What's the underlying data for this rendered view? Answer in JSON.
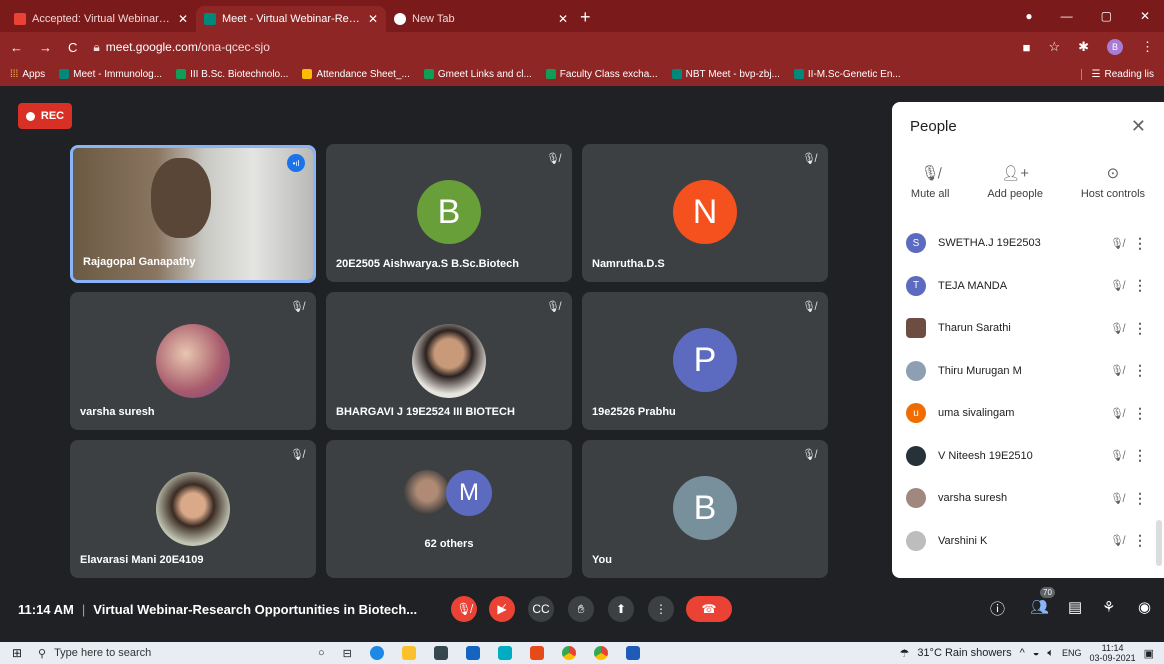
{
  "browser": {
    "tabs": [
      {
        "title": "Accepted: Virtual Webinar-Resea",
        "icon": "gmail-icon",
        "color": "#ea4335"
      },
      {
        "title": "Meet - Virtual Webinar-Resea",
        "icon": "meet-icon",
        "color": "#00897b"
      },
      {
        "title": "New Tab",
        "icon": "chrome-icon",
        "color": "#ffffff"
      }
    ],
    "url_host": "meet.google.com",
    "url_path": "/ona-qcec-sjo",
    "profile_initial": "B",
    "bookmarks": [
      "Apps",
      "Meet - Immunolog...",
      "III B.Sc. Biotechnolo...",
      "Attendance Sheet_...",
      "Gmeet Links and cl...",
      "Faculty Class excha...",
      "NBT Meet - bvp-zbj...",
      "II-M.Sc-Genetic En..."
    ],
    "reading_list": "Reading lis"
  },
  "meet": {
    "rec_label": "REC",
    "tiles": [
      {
        "name": "Rajagopal Ganapathy",
        "type": "video"
      },
      {
        "name": "20E2505 Aishwarya.S B.Sc.Biotech",
        "letter": "B",
        "color": "#689f38"
      },
      {
        "name": "Namrutha.D.S",
        "letter": "N",
        "color": "#f4511e"
      },
      {
        "name": "varsha suresh",
        "type": "photo"
      },
      {
        "name": "BHARGAVI J 19E2524 III BIOTECH",
        "type": "photo"
      },
      {
        "name": "19e2526 Prabhu",
        "letter": "P",
        "color": "#5c6bc0"
      },
      {
        "name": "Elavarasi Mani 20E4109",
        "type": "photo"
      },
      {
        "name": "62 others",
        "letter": "M",
        "color": "#5c6bc0"
      },
      {
        "name": "You",
        "letter": "B",
        "color": "#78909c"
      }
    ],
    "time": "11:14 AM",
    "meeting_title": "Virtual Webinar-Research Opportunities in Biotech...",
    "participant_count": "70"
  },
  "people": {
    "title": "People",
    "actions": [
      "Mute all",
      "Add people",
      "Host controls"
    ],
    "list": [
      {
        "name": "SWETHA.J 19E2503",
        "initial": "S",
        "color": "#5c6bc0"
      },
      {
        "name": "TEJA MANDA",
        "initial": "T",
        "color": "#5c6bc0"
      },
      {
        "name": "Tharun Sarathi",
        "initial": "",
        "color": "#6d4c41"
      },
      {
        "name": "Thiru Murugan M",
        "initial": "",
        "color": "#8d9fb3"
      },
      {
        "name": "uma sivalingam",
        "initial": "u",
        "color": "#ef6c00"
      },
      {
        "name": "V Niteesh 19E2510",
        "initial": "",
        "color": "#263238"
      },
      {
        "name": "varsha suresh",
        "initial": "",
        "color": "#a1887f"
      },
      {
        "name": "Varshini K",
        "initial": "",
        "color": "#bdbdbd"
      }
    ]
  },
  "taskbar": {
    "search_placeholder": "Type here to search",
    "weather": "31°C  Rain showers",
    "lang": "ENG",
    "clock_time": "11:14",
    "clock_date": "03-09-2021"
  }
}
